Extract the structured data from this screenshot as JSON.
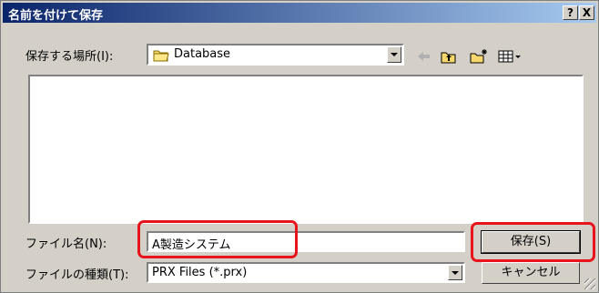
{
  "window": {
    "title": "名前を付けて保存",
    "help_btn": "?",
    "close_btn": "X"
  },
  "location": {
    "label": "保存する場所(I):",
    "value": "Database"
  },
  "toolbar": {
    "icons": [
      "back-arrow-icon",
      "up-folder-icon",
      "new-folder-icon",
      "view-menu-icon"
    ]
  },
  "filename": {
    "label": "ファイル名(N):",
    "value": "A製造システム"
  },
  "filetype": {
    "label": "ファイルの種類(T):",
    "value": "PRX Files (*.prx)"
  },
  "buttons": {
    "save": "保存(S)",
    "cancel": "キャンセル"
  },
  "colors": {
    "highlight": "#e8141c",
    "titlebar": "#0a246a"
  }
}
